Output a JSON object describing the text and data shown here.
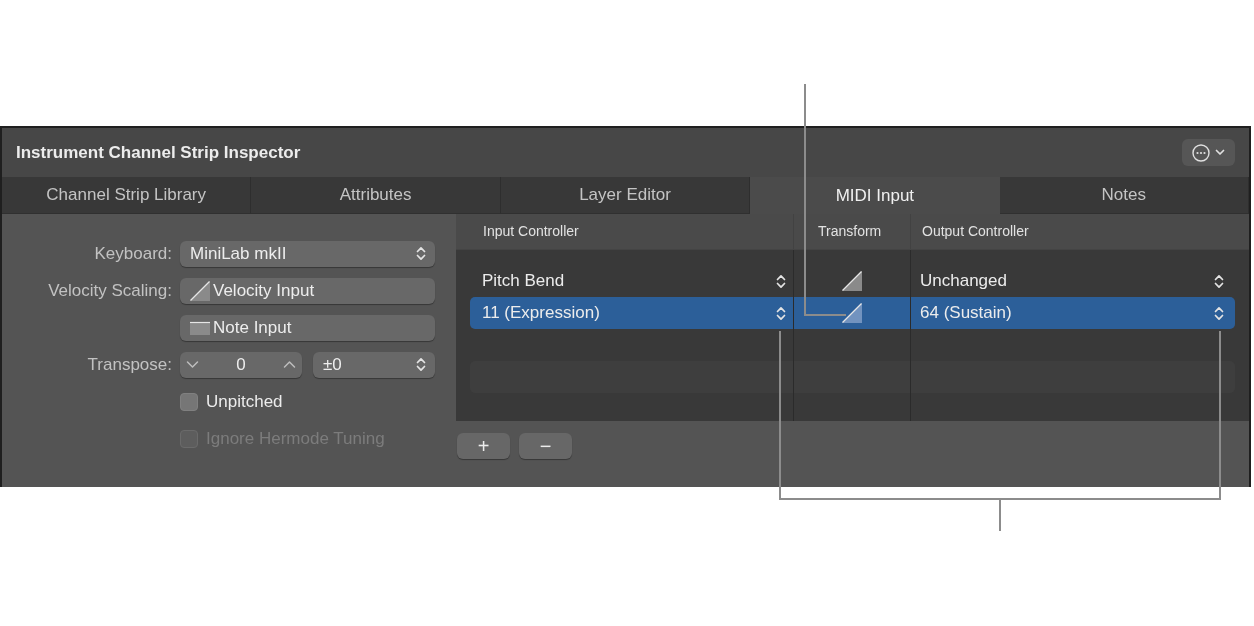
{
  "window": {
    "title": "Instrument Channel Strip Inspector"
  },
  "tabs": [
    {
      "label": "Channel Strip Library",
      "selected": false
    },
    {
      "label": "Attributes",
      "selected": false
    },
    {
      "label": "Layer Editor",
      "selected": false
    },
    {
      "label": "MIDI Input",
      "selected": true
    },
    {
      "label": "Notes",
      "selected": false
    }
  ],
  "attributes": {
    "rows": [
      {
        "kind": "popup",
        "label": "Keyboard:",
        "value": "MiniLab mkII"
      },
      {
        "kind": "velocity",
        "label": "Velocity Scaling:",
        "buttons": [
          "Velocity Input",
          "Note Input"
        ]
      },
      {
        "kind": "transpose",
        "label": "Transpose:",
        "stepper": "0",
        "popup": "±0"
      },
      {
        "kind": "checkbox",
        "value": "Unpitched",
        "checked": false,
        "disabled": false
      },
      {
        "kind": "checkbox",
        "value": "Ignore Hermode Tuning",
        "checked": false,
        "disabled": true
      }
    ]
  },
  "midi_input": {
    "columns": [
      "Input Controller",
      "Transform",
      "Output Controller"
    ],
    "rows": [
      {
        "input": "Pitch Bend",
        "output": "Unchanged",
        "selected": false
      },
      {
        "input": "11 (Expression)",
        "output": "64 (Sustain)",
        "selected": true
      }
    ],
    "buttons": [
      "+",
      "−"
    ]
  }
}
